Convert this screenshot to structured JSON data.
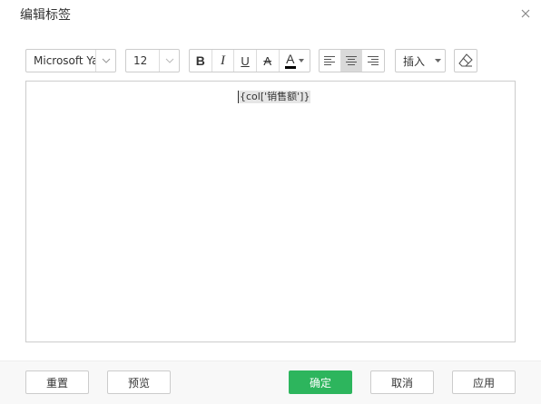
{
  "dialog": {
    "title": "编辑标签",
    "close_icon": "close-icon"
  },
  "toolbar": {
    "font_family": "Microsoft Yahei",
    "font_size": "12",
    "bold_label": "B",
    "italic_label": "I",
    "underline_label": "U",
    "strikethrough_label": "A",
    "font_color_label": "A",
    "font_color": "#000000",
    "align_left_icon": "align-left-icon",
    "align_center_icon": "align-center-icon",
    "align_right_icon": "align-right-icon",
    "align_active": "center",
    "insert_label": "插入",
    "clear_format_icon": "eraser-icon"
  },
  "editor": {
    "content": "{col['销售额']}"
  },
  "footer": {
    "reset_label": "重置",
    "preview_label": "预览",
    "confirm_label": "确定",
    "cancel_label": "取消",
    "apply_label": "应用"
  },
  "colors": {
    "primary": "#2db55d",
    "border": "#cccccc",
    "active_bg": "#d9d9d9"
  }
}
